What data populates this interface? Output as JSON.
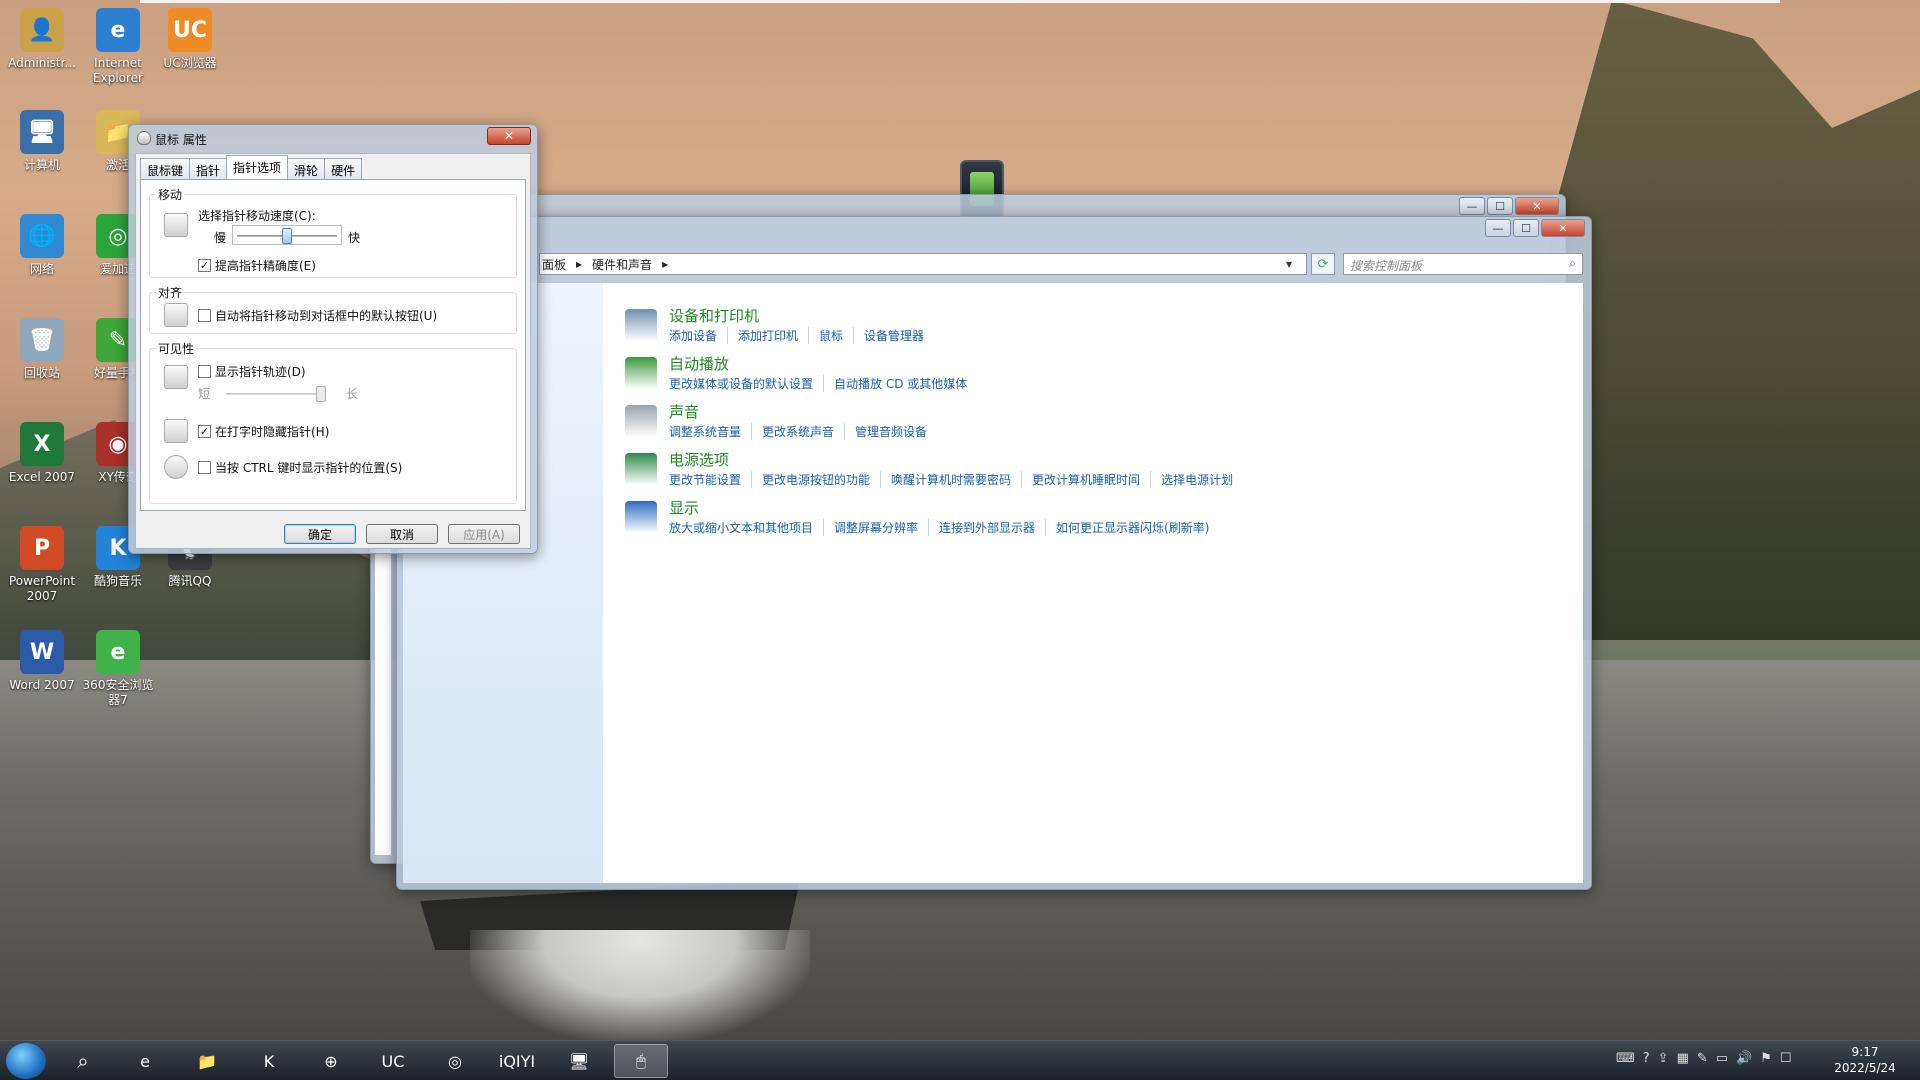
{
  "desktop": {
    "icons": [
      {
        "label": "Administr...",
        "glyph": "👤",
        "color": "#c9a24a"
      },
      {
        "label": "Internet Explorer",
        "glyph": "e",
        "color": "#2f7fd1"
      },
      {
        "label": "UC浏览器",
        "glyph": "UC",
        "color": "#f08a24"
      },
      {
        "label": "计算机",
        "glyph": "🖥",
        "color": "#3a6fa8"
      },
      {
        "label": "激活",
        "glyph": "📁",
        "color": "#d9b85a"
      },
      {
        "label": "网络",
        "glyph": "🌐",
        "color": "#2f8ad1"
      },
      {
        "label": "爱加速",
        "glyph": "◎",
        "color": "#2aa53a"
      },
      {
        "label": "回收站",
        "glyph": "🗑",
        "color": "#8fa7bd"
      },
      {
        "label": "好量手机",
        "glyph": "✎",
        "color": "#3fa63a"
      },
      {
        "label": "Excel 2007",
        "glyph": "X",
        "color": "#1f7a3a"
      },
      {
        "label": "XY传奇",
        "glyph": "◉",
        "color": "#a8302a"
      },
      {
        "label": "PowerPoint 2007",
        "glyph": "P",
        "color": "#d04a26"
      },
      {
        "label": "酷狗音乐",
        "glyph": "K",
        "color": "#2283d8"
      },
      {
        "label": "腾讯QQ",
        "glyph": "🐧",
        "color": "#3c3c3c"
      },
      {
        "label": "Word 2007",
        "glyph": "W",
        "color": "#2a5aa8"
      },
      {
        "label": "360安全浏览器7",
        "glyph": "e",
        "color": "#3fb34a"
      }
    ]
  },
  "control_panel": {
    "breadcrumb": [
      "面板",
      "▸",
      "硬件和声音",
      "▸"
    ],
    "search_placeholder": "搜索控制面板",
    "window_buttons": {
      "min": "—",
      "max": "☐",
      "close": "✕"
    },
    "categories": [
      {
        "title": "设备和打印机",
        "links": [
          "添加设备",
          "添加打印机",
          "鼠标",
          "设备管理器"
        ],
        "color": "#6f8fb3"
      },
      {
        "title": "自动播放",
        "links": [
          "更改媒体或设备的默认设置",
          "自动播放 CD 或其他媒体"
        ],
        "color": "#3a9a3f"
      },
      {
        "title": "声音",
        "links": [
          "调整系统音量",
          "更改系统声音",
          "管理音频设备"
        ],
        "color": "#9aa3ad"
      },
      {
        "title": "电源选项",
        "links": [
          "更改节能设置",
          "更改电源按钮的功能",
          "唤醒计算机时需要密码",
          "更改计算机睡眠时间",
          "选择电源计划"
        ],
        "color": "#2f8a4a"
      },
      {
        "title": "显示",
        "links": [
          "放大或缩小文本和其他项目",
          "调整屏幕分辨率",
          "连接到外部显示器",
          "如何更正显示器闪烁(刷新率)"
        ],
        "color": "#2e6bc2"
      }
    ]
  },
  "mouse_dialog": {
    "title": "鼠标 属性",
    "close": "✕",
    "tabs": [
      "鼠标键",
      "指针",
      "指针选项",
      "滑轮",
      "硬件"
    ],
    "active_tab": 2,
    "groups": {
      "motion": "移动",
      "snap": "对齐",
      "visibility": "可见性"
    },
    "speed_label": "选择指针移动速度(C):",
    "speed_slow": "慢",
    "speed_fast": "快",
    "speed_value": 0.5,
    "enhance_precision": {
      "label": "提高指针精确度(E)",
      "checked": true
    },
    "snap_to_default": {
      "label": "自动将指针移动到对话框中的默认按钮(U)",
      "checked": false
    },
    "pointer_trails": {
      "label": "显示指针轨迹(D)",
      "checked": false
    },
    "trail_short": "短",
    "trail_long": "长",
    "trail_value": 1.0,
    "hide_while_typing": {
      "label": "在打字时隐藏指针(H)",
      "checked": true
    },
    "show_location_ctrl": {
      "label": "当按 CTRL 键时显示指针的位置(S)",
      "checked": false
    },
    "buttons": {
      "ok": "确定",
      "cancel": "取消",
      "apply": "应用(A)"
    }
  },
  "taskbar": {
    "search_glyph": "⌕",
    "apps": [
      "e",
      "📁",
      "K",
      "⊕",
      "UC",
      "◎",
      "iQIYI",
      "🖥",
      "🖱"
    ],
    "active_index": 8,
    "tray": [
      "⌨",
      "?",
      "⇪",
      "▦",
      "✎",
      "▭",
      "🔊",
      "⚑",
      "☐"
    ],
    "time": "9:17",
    "date": "2022/5/24"
  }
}
